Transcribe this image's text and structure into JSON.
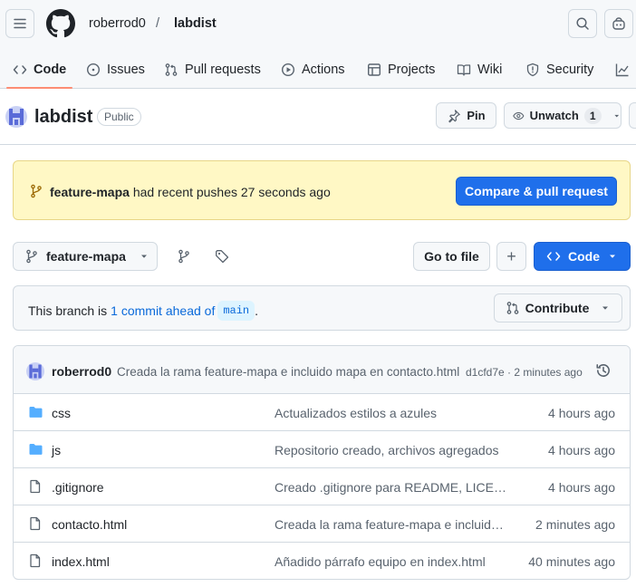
{
  "header": {
    "owner": "roberrod0",
    "separator": "/",
    "repo": "labdist"
  },
  "tabs": [
    {
      "label": "Code",
      "icon": "code-icon",
      "selected": true
    },
    {
      "label": "Issues",
      "icon": "issue-opened-icon"
    },
    {
      "label": "Pull requests",
      "icon": "git-pull-request-icon"
    },
    {
      "label": "Actions",
      "icon": "play-icon"
    },
    {
      "label": "Projects",
      "icon": "table-icon"
    },
    {
      "label": "Wiki",
      "icon": "book-icon"
    },
    {
      "label": "Security",
      "icon": "shield-icon"
    }
  ],
  "repo": {
    "name": "labdist",
    "visibility": "Public",
    "pin_label": "Pin",
    "watch_label": "Unwatch",
    "watch_count": "1"
  },
  "banner": {
    "branch": "feature-mapa",
    "message": "had recent pushes 27 seconds ago",
    "button": "Compare & pull request"
  },
  "branch_bar": {
    "branch": "feature-mapa",
    "goto_file": "Go to file",
    "add": "+",
    "code_button": "Code"
  },
  "ahead": {
    "prefix": "This branch is",
    "link": "1 commit ahead of",
    "base": "main",
    "suffix": ".",
    "contribute": "Contribute"
  },
  "latest_commit": {
    "author": "roberrod0",
    "message": "Creada la rama feature-mapa e incluido mapa en contacto.html",
    "meta": "d1cfd7e · 2 minutes ago"
  },
  "files": [
    {
      "name": "css",
      "type": "folder",
      "commit": "Actualizados estilos a azules",
      "time": "4 hours ago"
    },
    {
      "name": "js",
      "type": "folder",
      "commit": "Repositorio creado, archivos agregados",
      "time": "4 hours ago"
    },
    {
      "name": ".gitignore",
      "type": "file",
      "commit": "Creado .gitignore para README, LICENSE",
      "time": "4 hours ago"
    },
    {
      "name": "contacto.html",
      "type": "file",
      "commit": "Creada la rama feature-mapa e incluido mapa",
      "time": "2 minutes ago"
    },
    {
      "name": "index.html",
      "type": "file",
      "commit": "Añadido párrafo equipo en index.html",
      "time": "40 minutes ago"
    }
  ],
  "colors": {
    "accent": "#1f6feb",
    "banner_bg": "#fff8c5",
    "folder": "#54aeff",
    "tab_underline": "#fd8c73"
  }
}
